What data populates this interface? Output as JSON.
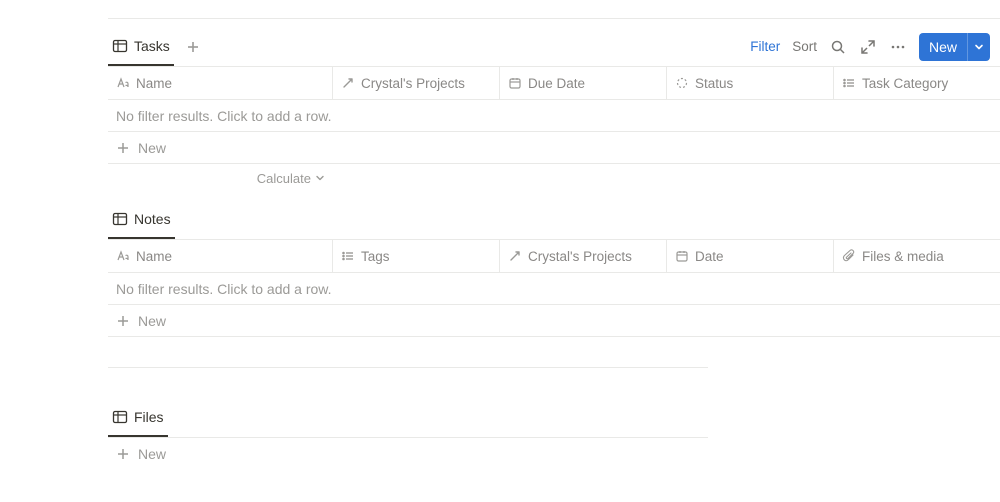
{
  "toolbar": {
    "filter": "Filter",
    "sort": "Sort",
    "new": "New"
  },
  "common": {
    "new_row": "New",
    "calculate": "Calculate",
    "empty": "No filter results. Click to add a row."
  },
  "tasks": {
    "tab": "Tasks",
    "cols": {
      "name": "Name",
      "projects": "Crystal's Projects",
      "due": "Due Date",
      "status": "Status",
      "category": "Task Category"
    }
  },
  "notes": {
    "tab": "Notes",
    "cols": {
      "name": "Name",
      "tags": "Tags",
      "projects": "Crystal's Projects",
      "date": "Date",
      "files": "Files & media"
    }
  },
  "files": {
    "tab": "Files"
  }
}
